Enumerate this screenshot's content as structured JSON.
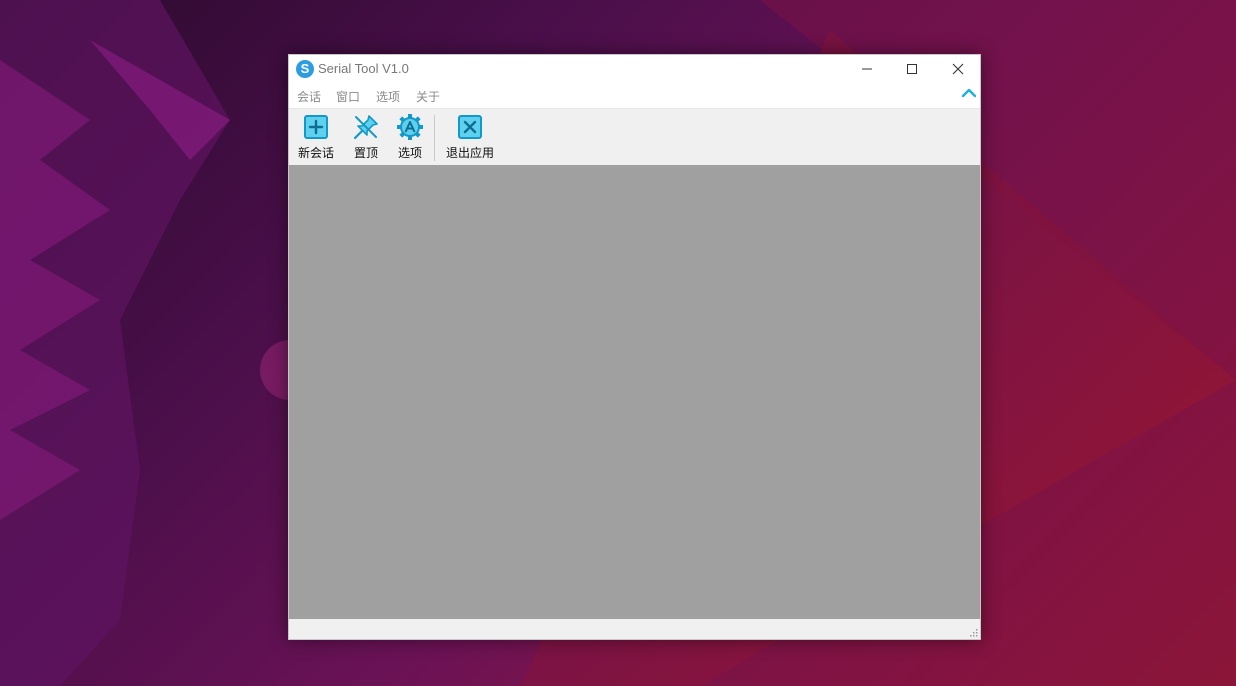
{
  "window": {
    "title": "Serial Tool V1.0",
    "icon_letter": "S",
    "icon_name": "app-logo-icon",
    "accent_color": "#2d9de0"
  },
  "menu": {
    "items": [
      "会话",
      "窗口",
      "选项",
      "关于"
    ]
  },
  "toolbar": {
    "buttons": [
      {
        "label": "新会话",
        "icon": "new-session-icon"
      },
      {
        "label": "置顶",
        "icon": "pin-icon"
      },
      {
        "label": "选项",
        "icon": "settings-icon"
      },
      {
        "label": "退出应用",
        "icon": "exit-icon"
      }
    ],
    "icon_color": "#1cb0dc"
  },
  "colors": {
    "workspace": "#a0a0a0",
    "toolbar_bg": "#f0f0f0"
  }
}
